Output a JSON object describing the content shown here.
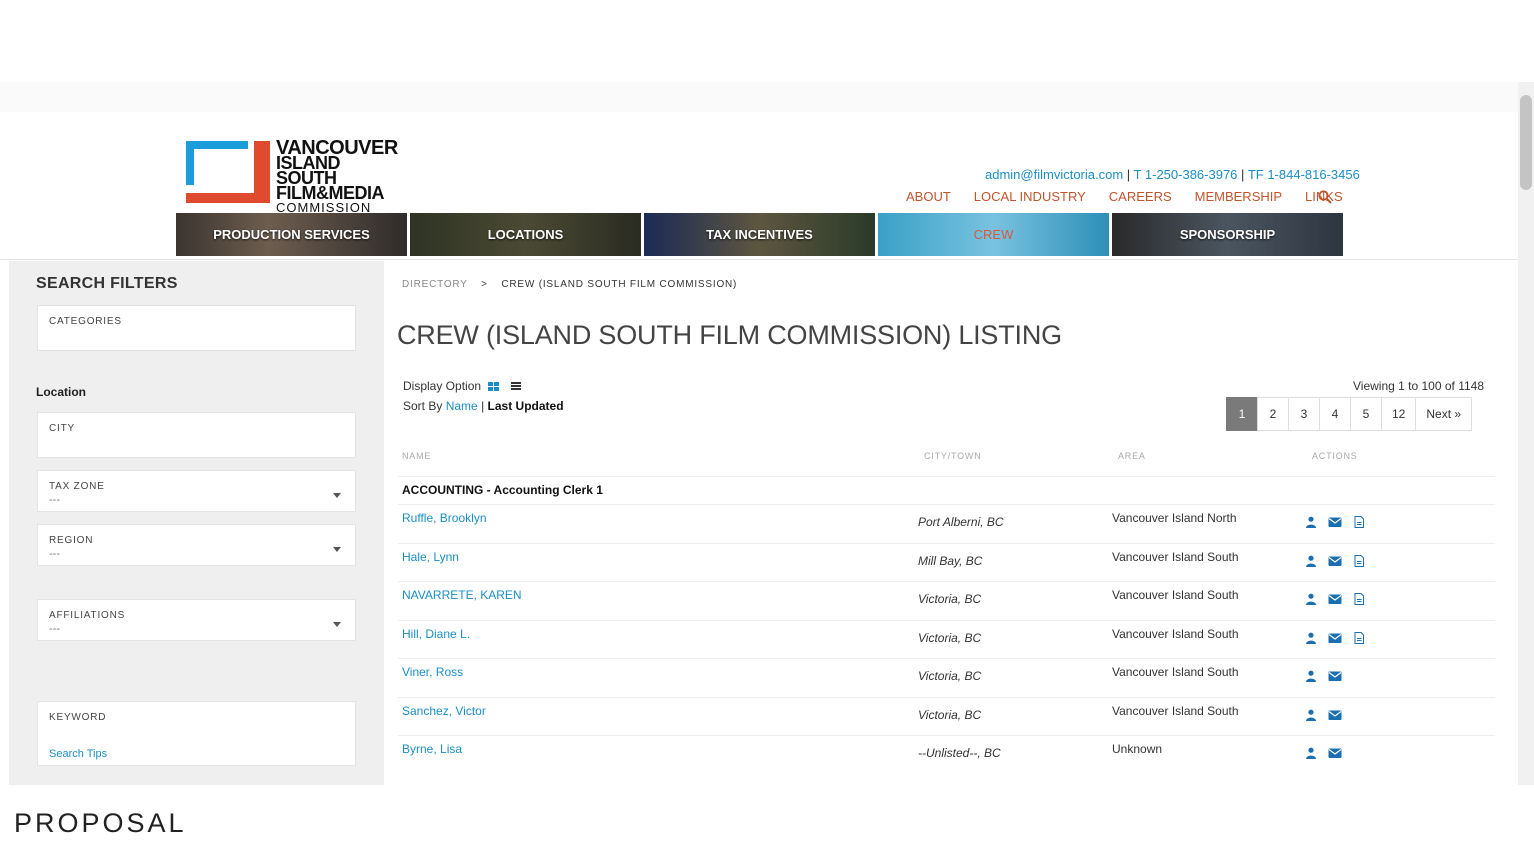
{
  "logo": {
    "line1": "VANCOUVER",
    "line2": "ISLAND SOUTH",
    "line3": "FILM&MEDIA",
    "line4": "COMMISSION"
  },
  "contact": {
    "email": "admin@filmvictoria.com",
    "phone": "T 1-250-386-3976",
    "tollfree": "TF 1-844-816-3456",
    "sep": "|"
  },
  "topnav": [
    "ABOUT",
    "LOCAL INDUSTRY",
    "CAREERS",
    "MEMBERSHIP",
    "LINKS"
  ],
  "mainnav": [
    "PRODUCTION SERVICES",
    "LOCATIONS",
    "TAX INCENTIVES",
    "CREW",
    "SPONSORSHIP"
  ],
  "sidebar": {
    "heading": "SEARCH FILTERS",
    "categories_label": "CATEGORIES",
    "location_heading": "Location",
    "city_label": "CITY",
    "tax_zone_label": "TAX ZONE",
    "tax_zone_value": "---",
    "region_label": "REGION",
    "region_value": "---",
    "affiliations_label": "AFFILIATIONS",
    "affiliations_value": "---",
    "keyword_label": "KEYWORD",
    "search_tips": "Search Tips"
  },
  "breadcrumb": {
    "root": "DIRECTORY",
    "chevron": ">",
    "current": "CREW (ISLAND SOUTH FILM COMMISSION)"
  },
  "title": "CREW (ISLAND SOUTH FILM COMMISSION) LISTING",
  "display_option_label": "Display Option",
  "sort": {
    "label": "Sort By",
    "name": "Name",
    "sep": "|",
    "last_updated": "Last Updated"
  },
  "viewing": "Viewing 1 to 100 of 1148",
  "pager": [
    "1",
    "2",
    "3",
    "4",
    "5",
    "12",
    "Next »"
  ],
  "table": {
    "headers": {
      "name": "NAME",
      "city": "CITY/TOWN",
      "area": "AREA",
      "actions": "ACTIONS"
    },
    "group": "ACCOUNTING - Accounting Clerk 1",
    "rows": [
      {
        "name": "Ruffle, Brooklyn",
        "city": "Port Alberni, BC",
        "area": "Vancouver Island North",
        "resume": true
      },
      {
        "name": "Hale, Lynn",
        "city": "Mill Bay, BC",
        "area": "Vancouver Island South",
        "resume": true
      },
      {
        "name": "NAVARRETE, KAREN",
        "city": "Victoria, BC",
        "area": "Vancouver Island South",
        "resume": true
      },
      {
        "name": "Hill, Diane L.",
        "city": "Victoria, BC",
        "area": "Vancouver Island South",
        "resume": true
      },
      {
        "name": "Viner, Ross",
        "city": "Victoria, BC",
        "area": "Vancouver Island South",
        "resume": false
      },
      {
        "name": "Sanchez, Victor",
        "city": "Victoria, BC",
        "area": "Vancouver Island South",
        "resume": false
      },
      {
        "name": "Byrne, Lisa",
        "city": "--Unlisted--, BC",
        "area": "Unknown",
        "resume": false
      }
    ]
  },
  "caption": "PROPOSAL",
  "colors": {
    "accent": "#1a8fc5",
    "nav": "#c0552c",
    "logo_blue": "#1a9dd8",
    "logo_red": "#e04a2f"
  }
}
